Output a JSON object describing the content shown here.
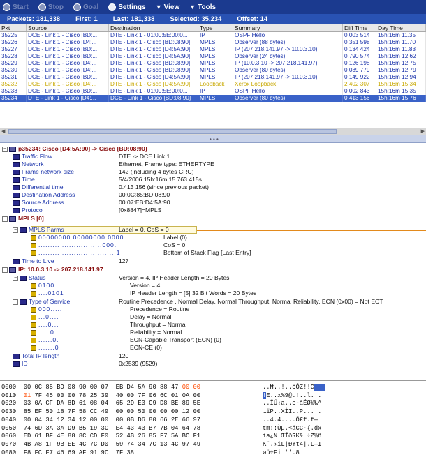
{
  "toolbar": {
    "start": "Start",
    "stop": "Stop",
    "goal": "Goal",
    "settings": "Settings",
    "view": "View",
    "tools": "Tools"
  },
  "status": {
    "packets": "Packets: 181,338",
    "first": "First: 1",
    "last": "Last: 181,338",
    "selected": "Selected: 35,234",
    "offset": "Offset: 14"
  },
  "grid": {
    "columns": [
      "Pkt",
      "Source",
      "Destination",
      "Type",
      "Summary",
      "Diff Time",
      "Day Time"
    ],
    "rows": [
      [
        "35225",
        "DCE - Link 1 - Cisco [BD:...",
        "DTE - Link 1 - 01:00:5E:00:0...",
        "IP",
        "OSPF Hello",
        "0.003 514",
        "15h:16m 11.35"
      ],
      [
        "35226",
        "DCE - Link 1 - Cisco [D4:...",
        "DTE - Link 1 - Cisco [BD:08:90]",
        "MPLS",
        "Observer (88 bytes)",
        "0.351 598",
        "15h:16m 11.70"
      ],
      [
        "35227",
        "DCE - Link 1 - Cisco [BD:...",
        "DTE - Link 1 - Cisco [D4:5A:90]",
        "MPLS",
        "IP (207.218.141.97 -> 10.0.3.10)",
        "0.134 424",
        "15h:16m 11.83"
      ],
      [
        "35228",
        "DCE - Link 1 - Cisco [BD:...",
        "DTE - Link 1 - Cisco [D4:5A:90]",
        "MPLS",
        "Observer (24 bytes)",
        "0.790 574",
        "15h:16m 12.62"
      ],
      [
        "35229",
        "DCE - Link 1 - Cisco [D4:...",
        "DTE - Link 1 - Cisco [BD:08:90]",
        "MPLS",
        "IP (10.0.3.10 -> 207.218.141.97)",
        "0.126 198",
        "15h:16m 12.75"
      ],
      [
        "35230",
        "DCE - Link 1 - Cisco [D4:...",
        "DTE - Link 1 - Cisco [BD:08:90]",
        "MPLS",
        "Observer (80 bytes)",
        "0.039 779",
        "15h:16m 12.79"
      ],
      [
        "35231",
        "DCE - Link 1 - Cisco [BD:...",
        "DTE - Link 1 - Cisco [D4:5A:90]",
        "MPLS",
        "IP (207.218.141.97 -> 10.0.3.10)",
        "0.149 922",
        "15h:16m 12.94"
      ],
      [
        "35232",
        "DCE - Link 1 - Cisco [D4:...",
        "DTE - Link 1 - Cisco [D4:5A:90]",
        "Loopback",
        "Xerox Loopback",
        "2.402 307",
        "15h:16m 15.34"
      ],
      [
        "35233",
        "DCE - Link 1 - Cisco [BD:...",
        "DTE - Link 1 - 01:00:5E:00:0...",
        "IP",
        "OSPF Hello",
        "0.002 843",
        "15h:16m 15.35"
      ],
      [
        "35234",
        "DTE - Link 1 - Cisco [D4:...",
        "DCE - Link 1 - Cisco [BD:08:90]",
        "MPLS",
        "Observer (80 bytes)",
        "0.413 156",
        "15h:16m 15.76"
      ]
    ],
    "row_styles": [
      "blue",
      "blue",
      "blue",
      "blue",
      "blue",
      "blue",
      "blue",
      "yellow",
      "blue",
      "sel"
    ]
  },
  "detail": {
    "packet_header": "p35234:  Cisco [D4:5A:90] -> Cisco [BD:08:90]",
    "traffic_flow_label": "Traffic Flow",
    "traffic_flow_value": "DTE -> DCE Link 1",
    "network_label": "Network",
    "network_value": "Ethernet,  Frame type:  ETHERTYPE",
    "frame_size_label": "Frame network size",
    "frame_size_value": "142 (including 4 bytes CRC)",
    "time_label": "Time",
    "time_value": "5/4/2006  15h:16m:15.763 415s",
    "diff_label": "Differential time",
    "diff_value": "0.413 156  (since previous packet)",
    "dest_label": "Destination Address",
    "dest_value": "00:0C:85:BD:08:90",
    "src_label": "Source Address",
    "src_value": "00:07:EB:D4:5A:90",
    "proto_label": "Protocol",
    "proto_value": "[0x8847]=MPLS",
    "mpls_header": "MPLS [0]",
    "mpls_parms_label": "MPLS Parms",
    "mpls_parms_value": "Label = 0, CoS = 0",
    "mpls_bits1": "00000000  00000000  0000....",
    "mpls_bits1_value": "Label (0)",
    "mpls_bits2": ".........  ...........  .....000.",
    "mpls_bits2_value": "CoS = 0",
    "mpls_bits3": ".........  ...........  ...........1",
    "mpls_bits3_value": "Bottom of Stack Flag [Last Entry]",
    "ttl_label": "Time to Live",
    "ttl_value": "127",
    "ip_prefix": "IP:",
    "ip_header": "10.0.3.10 -> 207.218.141.97",
    "status_label": "Status",
    "status_value": "Version = 4,  IP Header Length = 20 Bytes",
    "status_bits1": "0100....",
    "status_bits1_value": "Version = 4",
    "status_bits2": "....0101",
    "status_bits2_value": "IP Header Length = [5] 32 Bit Words = 20 Bytes",
    "tos_label": "Type of Service",
    "tos_value": "Routine Precedence ,  Normal Delay,  Normal Throughput,  Normal Reliability,  ECN (0x00) = Not ECT",
    "tos_bits1": "000.....",
    "tos_bits1_value": "Precedence = Routine",
    "tos_bits2": "...0....",
    "tos_bits2_value": "Delay = Normal",
    "tos_bits3": "....0...",
    "tos_bits3_value": "Throughput = Normal",
    "tos_bits4": ".....0..",
    "tos_bits4_value": "Reliability = Normal",
    "tos_bits5": "......0.",
    "tos_bits5_value": "ECN-Capable Transport (ECN) (0)",
    "tos_bits6": ".......0",
    "tos_bits6_value": "ECN-CE (0)",
    "total_len_label": "Total IP length",
    "total_len_value": "120",
    "id_label": "ID",
    "id_value": "0x2539 (9529)"
  },
  "hex": {
    "rows": [
      {
        "offset": "0000",
        "bytes": "00 0C 85 BD 08 90 00 07  EB D4 5A 90 88 47",
        "bytes_hl": "00 00",
        "ascii": "..Ħ..!..ëÔZ!!G",
        "ascii_hl": "   "
      },
      {
        "offset": "0010",
        "red": "01",
        "bytes": " 7F 45 00 00 78 25 39  40 00 7F 06 6C 01 0A 00",
        "ascii_sel": "!",
        "ascii": "E..x%9@.!..l..."
      },
      {
        "offset": "0020",
        "bytes": "03 0A CF DA 8D 61 08 04  65 2D E3 C9 D8 BE 89 5E",
        "ascii": "..ÏÚ‹a..e-ãÉØ¾‰^"
      },
      {
        "offset": "0030",
        "bytes": "85 EF 50 18 7F 58 CC 49  00 00 50 00 00 00 12 00",
        "ascii": "…ïP..XÌI..P....."
      },
      {
        "offset": "0040",
        "bytes": "00 04 34 12 34 12 00 00  00 0B D6 80 66 2E 66 97",
        "ascii": "..4.4....Ö€f.f—"
      },
      {
        "offset": "0050",
        "bytes": "74 6D 3A 3A D9 B5 19 3C  E4 43 43 B7 7B 04 64 78",
        "ascii": "tm::Ùµ.<äCC·{.dx"
      },
      {
        "offset": "0060",
        "bytes": "ED 61 BF 4E 88 8C CD F0  52 4B 26 85 F7 5A BC F1",
        "ascii": "ía¿N ŒÍðRK&…÷Z¼ñ"
      },
      {
        "offset": "0070",
        "bytes": "4B A8 1F 9B EE 4C 7C D0  59 74 34 7C 13 4C 97 49",
        "ascii": "K¨.›îL|ÐYt4|.L—I"
      },
      {
        "offset": "0080",
        "bytes": "F8 FC F7 46 69 AF 91 9C  7F 38",
        "ascii": "øü÷Fi¯''.8"
      }
    ]
  },
  "colors": {
    "toolbar": "#1b3a8f",
    "status": "#2952b3",
    "selected": "#3a62c8",
    "header_red": "#8a1010",
    "orange": "#e38a1c",
    "hex_red": "#ff4a00"
  }
}
